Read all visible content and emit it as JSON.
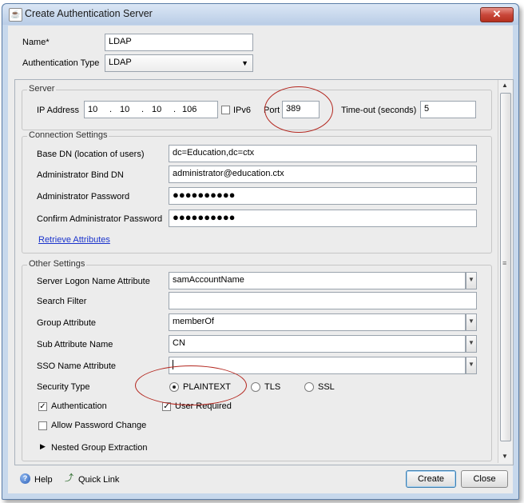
{
  "window": {
    "title": "Create Authentication Server",
    "close_glyph": "✕"
  },
  "top": {
    "name_label": "Name*",
    "name_value": "LDAP",
    "auth_type_label": "Authentication Type",
    "auth_type_value": "LDAP"
  },
  "server": {
    "title": "Server",
    "ip_label": "IP Address",
    "ip_octets": [
      "10",
      "10",
      "10",
      "106"
    ],
    "ipv6_label": "IPv6",
    "ipv6_checked": false,
    "port_label": "Port",
    "port_value": "389",
    "timeout_label": "Time-out (seconds)",
    "timeout_value": "5"
  },
  "connection": {
    "title": "Connection Settings",
    "base_dn_label": "Base DN (location of users)",
    "base_dn_value": "dc=Education,dc=ctx",
    "bind_dn_label": "Administrator Bind DN",
    "bind_dn_value": "administrator@education.ctx",
    "password_label": "Administrator Password",
    "password_value": "●●●●●●●●●●",
    "confirm_label": "Confirm Administrator Password",
    "confirm_value": "●●●●●●●●●●",
    "retrieve_link": "Retrieve Attributes"
  },
  "other": {
    "title": "Other Settings",
    "logon_attr_label": "Server Logon Name Attribute",
    "logon_attr_value": "samAccountName",
    "search_filter_label": "Search Filter",
    "search_filter_value": "",
    "group_attr_label": "Group Attribute",
    "group_attr_value": "memberOf",
    "sub_attr_label": "Sub Attribute Name",
    "sub_attr_value": "CN",
    "sso_label": "SSO Name Attribute",
    "sso_value": "",
    "security_type_label": "Security Type",
    "security_options": [
      "PLAINTEXT",
      "TLS",
      "SSL"
    ],
    "security_selected": "PLAINTEXT",
    "authentication_label": "Authentication",
    "authentication_checked": true,
    "user_required_label": "User Required",
    "user_required_checked": true,
    "allow_pw_change_label": "Allow Password Change",
    "allow_pw_change_checked": false,
    "nested_label": "Nested Group Extraction"
  },
  "footer": {
    "help_label": "Help",
    "quick_link_label": "Quick Link",
    "create_label": "Create",
    "close_label": "Close"
  },
  "colors": {
    "annotation_circle": "#b3261e",
    "link": "#1a33cc"
  }
}
